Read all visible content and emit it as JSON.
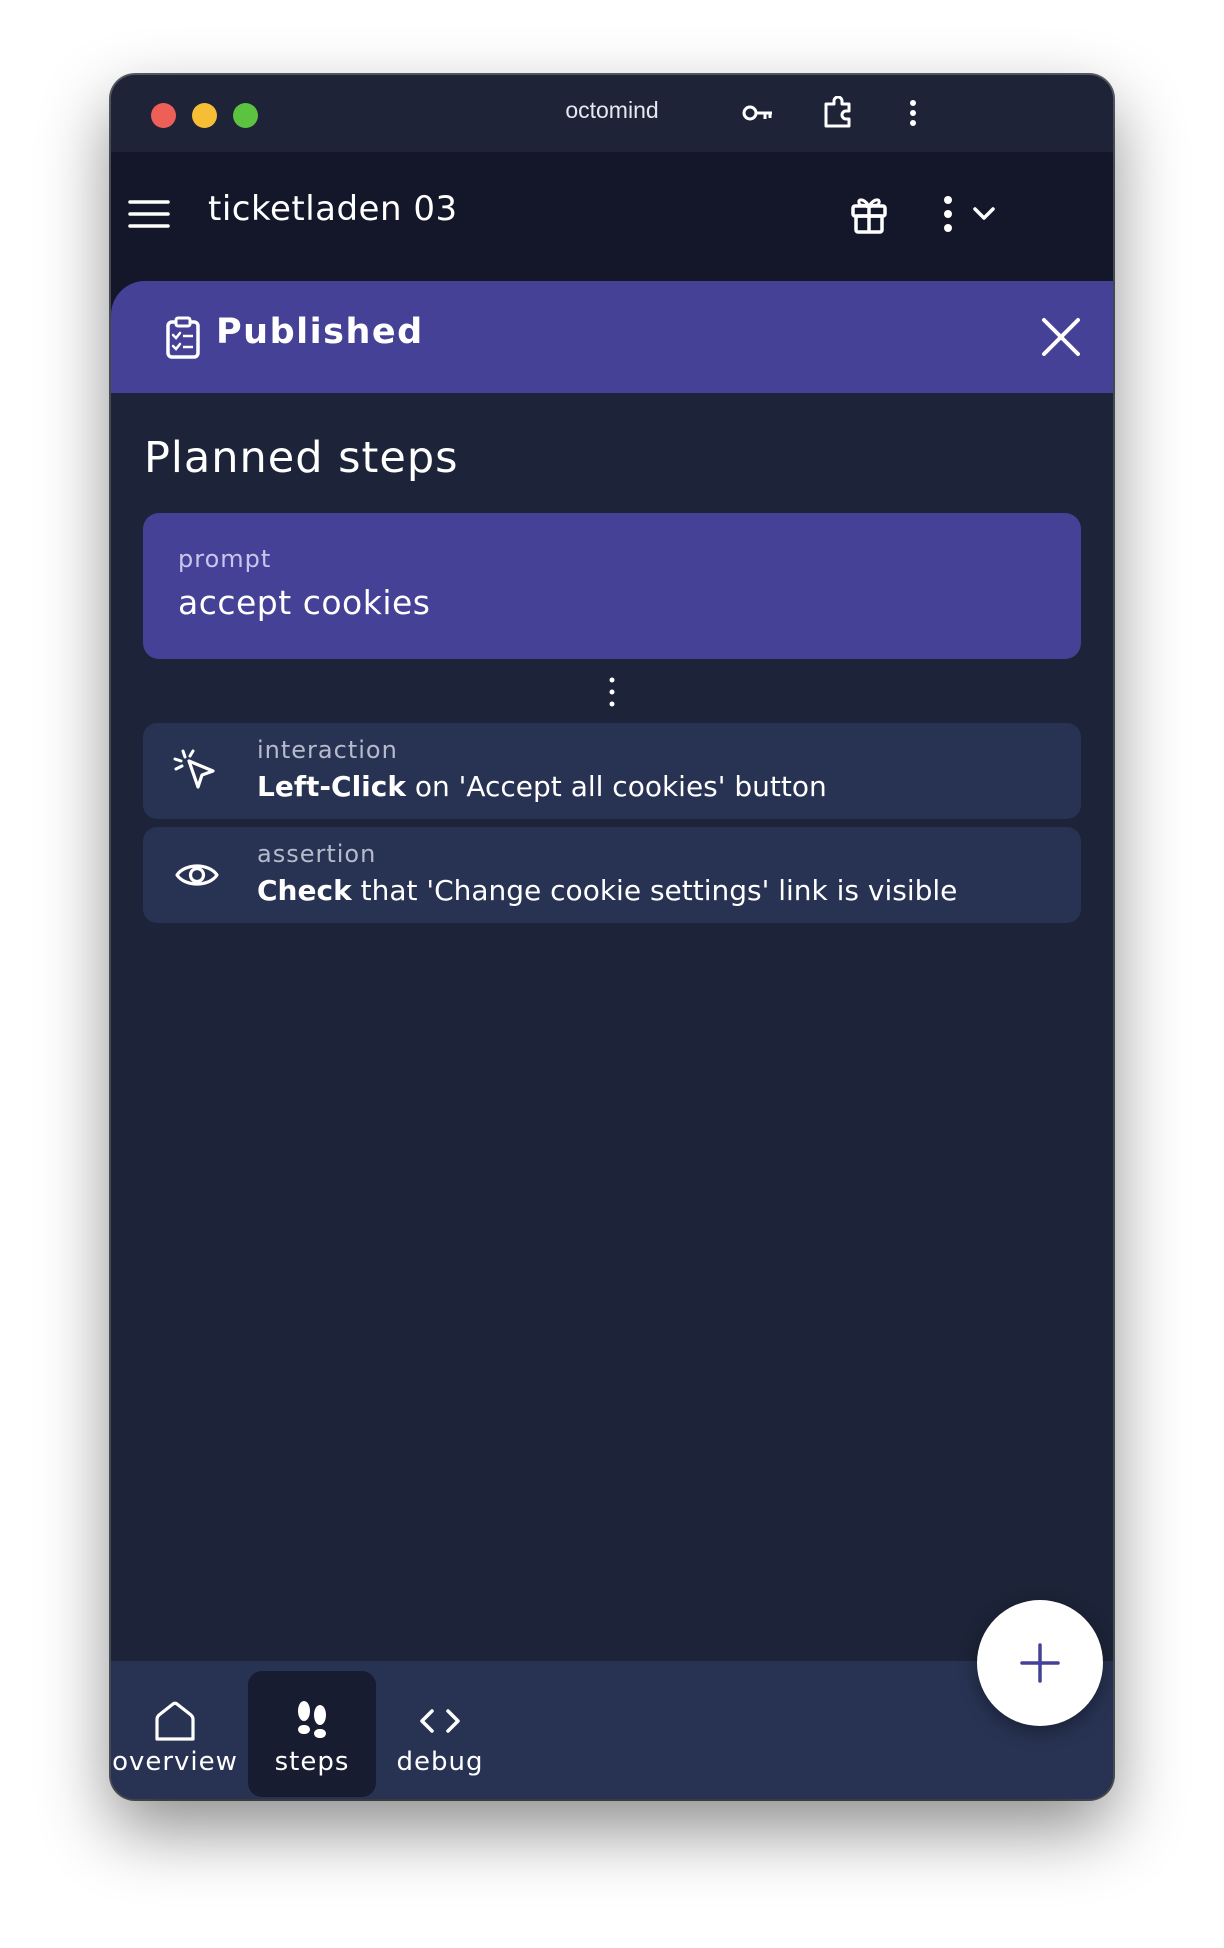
{
  "window": {
    "title": "octomind"
  },
  "appbar": {
    "title": "ticketladen 03"
  },
  "status_bar": {
    "label": "Published"
  },
  "planned_steps": {
    "heading": "Planned steps",
    "prompt": {
      "kind": "prompt",
      "text": "accept cookies"
    },
    "steps": [
      {
        "kind": "interaction",
        "action": "Left-Click",
        "detail": " on 'Accept all cookies' button",
        "icon": "cursor-click-icon"
      },
      {
        "kind": "assertion",
        "action": "Check",
        "detail": " that 'Change cookie settings' link is visible",
        "icon": "eye-icon"
      }
    ]
  },
  "bottom_nav": {
    "items": [
      {
        "label": "overview",
        "icon": "home-icon",
        "active": false
      },
      {
        "label": "steps",
        "icon": "footsteps-icon",
        "active": true
      },
      {
        "label": "debug",
        "icon": "code-icon",
        "active": false
      }
    ]
  },
  "fab": {
    "icon": "plus-icon"
  },
  "colors": {
    "background": "#1d2338",
    "appbar": "#141729",
    "accent": "#454196",
    "card": "#283353",
    "nav_active": "#181c30"
  }
}
